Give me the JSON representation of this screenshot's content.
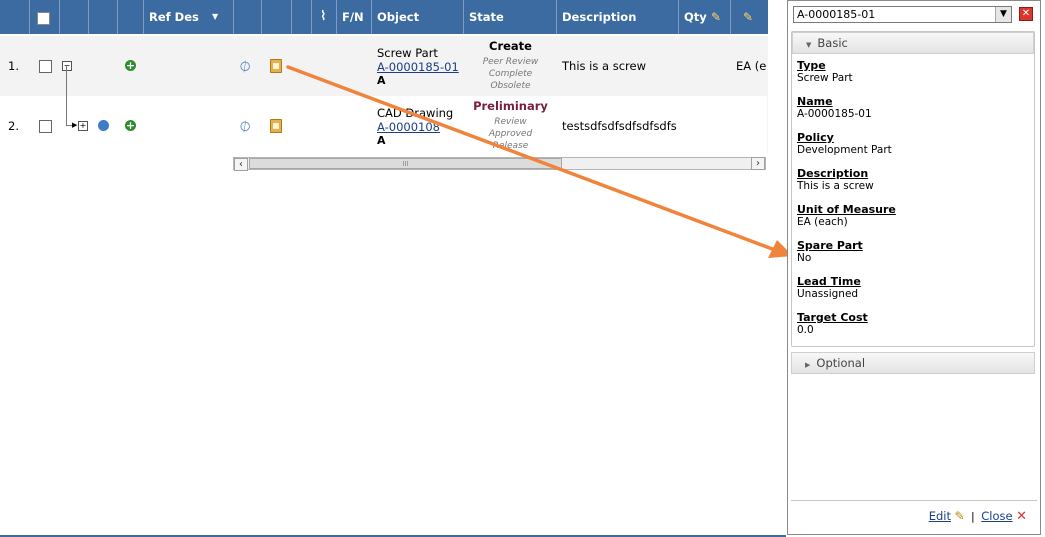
{
  "grid": {
    "columns": {
      "ref_des": "Ref Des",
      "sort_indicator": "▼",
      "fn": "F/N",
      "object": "Object",
      "state": "State",
      "description": "Description",
      "qty": "Qty",
      "partial_value": "EA (e"
    },
    "rows": [
      {
        "num": "1.",
        "object_name": "Screw Part",
        "object_link": "A-0000185-01",
        "object_rev": "A",
        "state_current": "Create",
        "state_others": [
          "Peer Review",
          "Complete",
          "Obsolete"
        ],
        "description": "This is a screw",
        "unit_partial": "EA (e"
      },
      {
        "num": "2.",
        "object_name": "CAD Drawing",
        "object_link": "A-0000108",
        "object_rev": "A",
        "state_current": "Preliminary",
        "state_others": [
          "Review",
          "Approved",
          "Release"
        ],
        "description": "testsdfsdfsdfsdfsdfs"
      }
    ],
    "scroll_thumb_label": "III"
  },
  "panel": {
    "selected_object": "A-0000185-01",
    "basic_label": "Basic",
    "optional_label": "Optional",
    "fields": [
      {
        "label": "Type",
        "value": "Screw Part"
      },
      {
        "label": "Name",
        "value": "A-0000185-01"
      },
      {
        "label": "Policy",
        "value": "Development Part"
      },
      {
        "label": "Description",
        "value": "This is a screw"
      },
      {
        "label": "Unit of Measure",
        "value": "EA (each)"
      },
      {
        "label": "Spare Part",
        "value": "No"
      },
      {
        "label": "Lead Time",
        "value": "Unassigned"
      },
      {
        "label": "Target Cost",
        "value": "0.0"
      }
    ],
    "edit_label": "Edit",
    "separator": "|",
    "close_label": "Close"
  },
  "colors": {
    "header_bg": "#3b6ba1",
    "link": "#1a3f86",
    "state_preliminary": "#7a1f3d",
    "arrow": "#f0843c"
  },
  "icons": [
    "checkbox-icon",
    "collapse-icon",
    "expand-icon",
    "add-icon",
    "navigate-icon",
    "link-icon",
    "properties-icon",
    "paperclip-icon",
    "edit-pencil-icon",
    "close-icon",
    "dropdown-arrow-icon"
  ]
}
